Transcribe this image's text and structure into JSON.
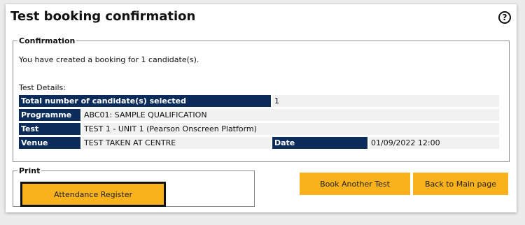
{
  "page": {
    "title": "Test booking confirmation",
    "help_icon": "?"
  },
  "confirmation": {
    "legend": "Confirmation",
    "message": "You have created a booking for 1 candidate(s).",
    "details_label": "Test Details:",
    "rows": {
      "total": {
        "label": "Total number of candidate(s) selected",
        "value": "1"
      },
      "programme": {
        "label": "Programme",
        "value": "ABC01: SAMPLE QUALIFICATION"
      },
      "test": {
        "label": "Test",
        "value": "TEST 1 - UNIT 1 (Pearson Onscreen Platform)"
      },
      "venue": {
        "label": "Venue",
        "value": "TEST TAKEN AT CENTRE"
      },
      "date": {
        "label": "Date",
        "value": "01/09/2022 12:00"
      }
    }
  },
  "print": {
    "legend": "Print",
    "attendance_label": "Attendance Register"
  },
  "actions": {
    "book_another_label": "Book Another Test",
    "back_main_label": "Back to Main page"
  },
  "colors": {
    "header_bg": "#0b2c5b",
    "button_bg": "#f9b21b",
    "value_bg": "#f1f1f1"
  }
}
